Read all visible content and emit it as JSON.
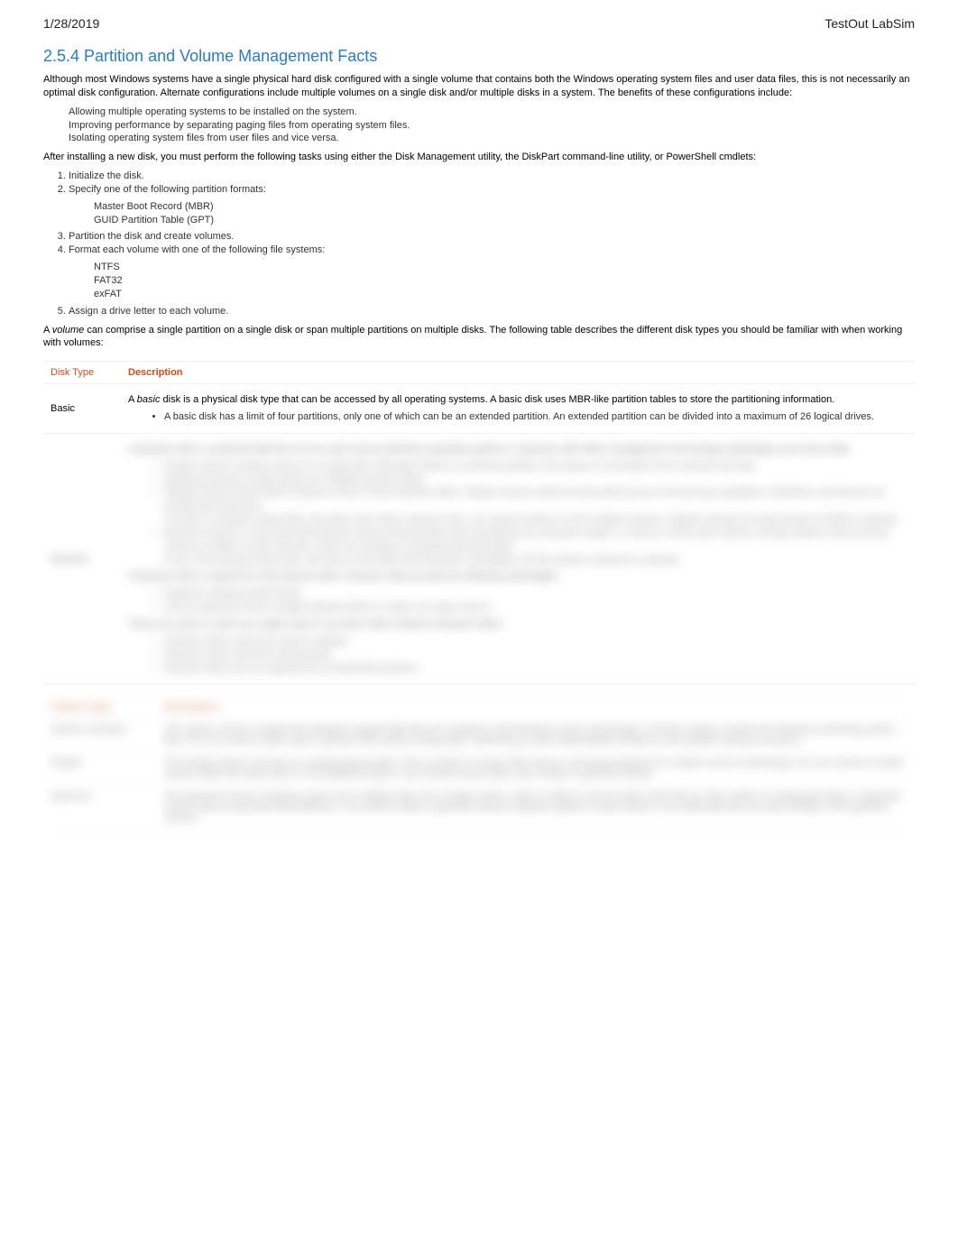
{
  "header": {
    "date": "1/28/2019",
    "app": "TestOut LabSim"
  },
  "title": "2.5.4 Partition and Volume Management Facts",
  "intro": "Although most Windows systems have a single physical hard disk configured with a single volume that contains both the Windows operating system files and user data files, this is not necessarily an optimal disk configuration. Alternate configurations include multiple volumes on a single disk and/or multiple disks in a system. The benefits of these configurations include:",
  "benefits": [
    "Allowing multiple operating systems to be installed on the system.",
    "Improving performance by separating paging files from operating system files.",
    "Isolating operating system files from user files and vice versa."
  ],
  "after_install": "After installing a new disk, you must perform the following tasks using either the Disk Management utility, the DiskPart command-line utility, or PowerShell cmdlets:",
  "steps": [
    {
      "text": "Initialize the disk."
    },
    {
      "text": "Specify one of the following partition formats:",
      "sub": [
        "Master Boot Record (MBR)",
        "GUID Partition Table (GPT)"
      ]
    },
    {
      "text": "Partition the disk and create volumes."
    },
    {
      "text": "Format each volume with one of the following file systems:",
      "sub": [
        "NTFS",
        "FAT32",
        "exFAT"
      ]
    },
    {
      "text": "Assign a drive letter to each volume."
    }
  ],
  "volume_note_pre": "A ",
  "volume_note_em": "volume",
  "volume_note_post": " can comprise a single partition on a single disk or span multiple partitions on multiple disks. The following table describes the different disk types you should be familiar with when working with volumes:",
  "table": {
    "headers": {
      "c1": "Disk Type",
      "c2": "Description"
    },
    "rows": [
      {
        "type": "Basic",
        "desc_p1_pre": "A ",
        "desc_p1_em": "basic",
        "desc_p1_post": " disk is a physical disk type that can be accessed by all operating systems. A basic disk uses MBR-like partition tables to store the partitioning information.",
        "desc_li1": "A basic disk has a limit of four partitions, only one of which can be an extended partition. An extended partition can be divided into a maximum of 26 logical drives."
      }
    ]
  },
  "blur": {
    "row2_type": "Dynamic",
    "lines": [
      "A dynamic disk is a physical disk that can be used only by Windows operating systems. A dynamic disk offers management and storage advantages over basic disks.",
      "Simple volume contains space on a single disk. Although similar to a primary partition, this space is not limited to four volumes per disk.",
      "Spanned volumes contain space on multiple dynamic disks.",
      "Striped volume stores data in stripes on two or more dynamic disks. Striped volumes offer the best performance of all volumes available in Windows, but they do not provide fault tolerance.",
      "If a disk in a striped volume fails, the data in the entire volume is lost. You cannot extend or mirror striped volumes. Striped volumes are also known as RAID-0 volumes.",
      "Mirrored volume is a two-disk fault-tolerant volume that provides data redundancy by using two copies, or mirrors, of the same volume. All data written to the mirrored volume is written to both volumes, which are located on separate physical disks.",
      "If one of the physical disks fails, the data on the failed disk becomes unavailable, but the system continues to operate.",
      "A dynamic disk is required for fault tolerant disks. Dynamic disks provide the following advantages: ",
      "Supports software-based RAID",
      "Can be spanned across multiple physical disks to create one large volume.",
      "There are cases in which you might need to use basic disks instead of dynamic disks:",
      "Dynamic disks cannot be used on laptops.",
      "Dynamic disks cannot be dual-booted.",
      "Dynamic disks are not supported by all operating systems."
    ],
    "vol_header_c1": "Volume Type",
    "vol_header_c2": "Description",
    "vol_rows": [
      {
        "t": "System and Boot",
        "d": "The system volume contains the hardware-specific files that are needed to start Windows (such as Bootmgr). The boot volume contains the Windows operating system files. You can convert: Basic disk to dynamic disk without losing data. Performing a clean install deletes all data on the partition during conversion."
      },
      {
        "t": "Simple",
        "d": "The simple volume must be on a single physical disk. This is similar to a basic disk volume. Increasing capacity of a simple volume (extending): You can extend a simple volume within the same disk or onto additional disks. If you extend across disks, this creates a spanned volume."
      },
      {
        "t": "Spanned",
        "d": "The spanned volume combines space from multiple disks into a single volume. Data is written to the first disk until it fills up, then written to subsequent disks. A spanned volume does not provide fault tolerance. You cannot create a spanned volume using the system or boot volume. If one disk fails then you lose all data in the spanned volume."
      }
    ]
  }
}
